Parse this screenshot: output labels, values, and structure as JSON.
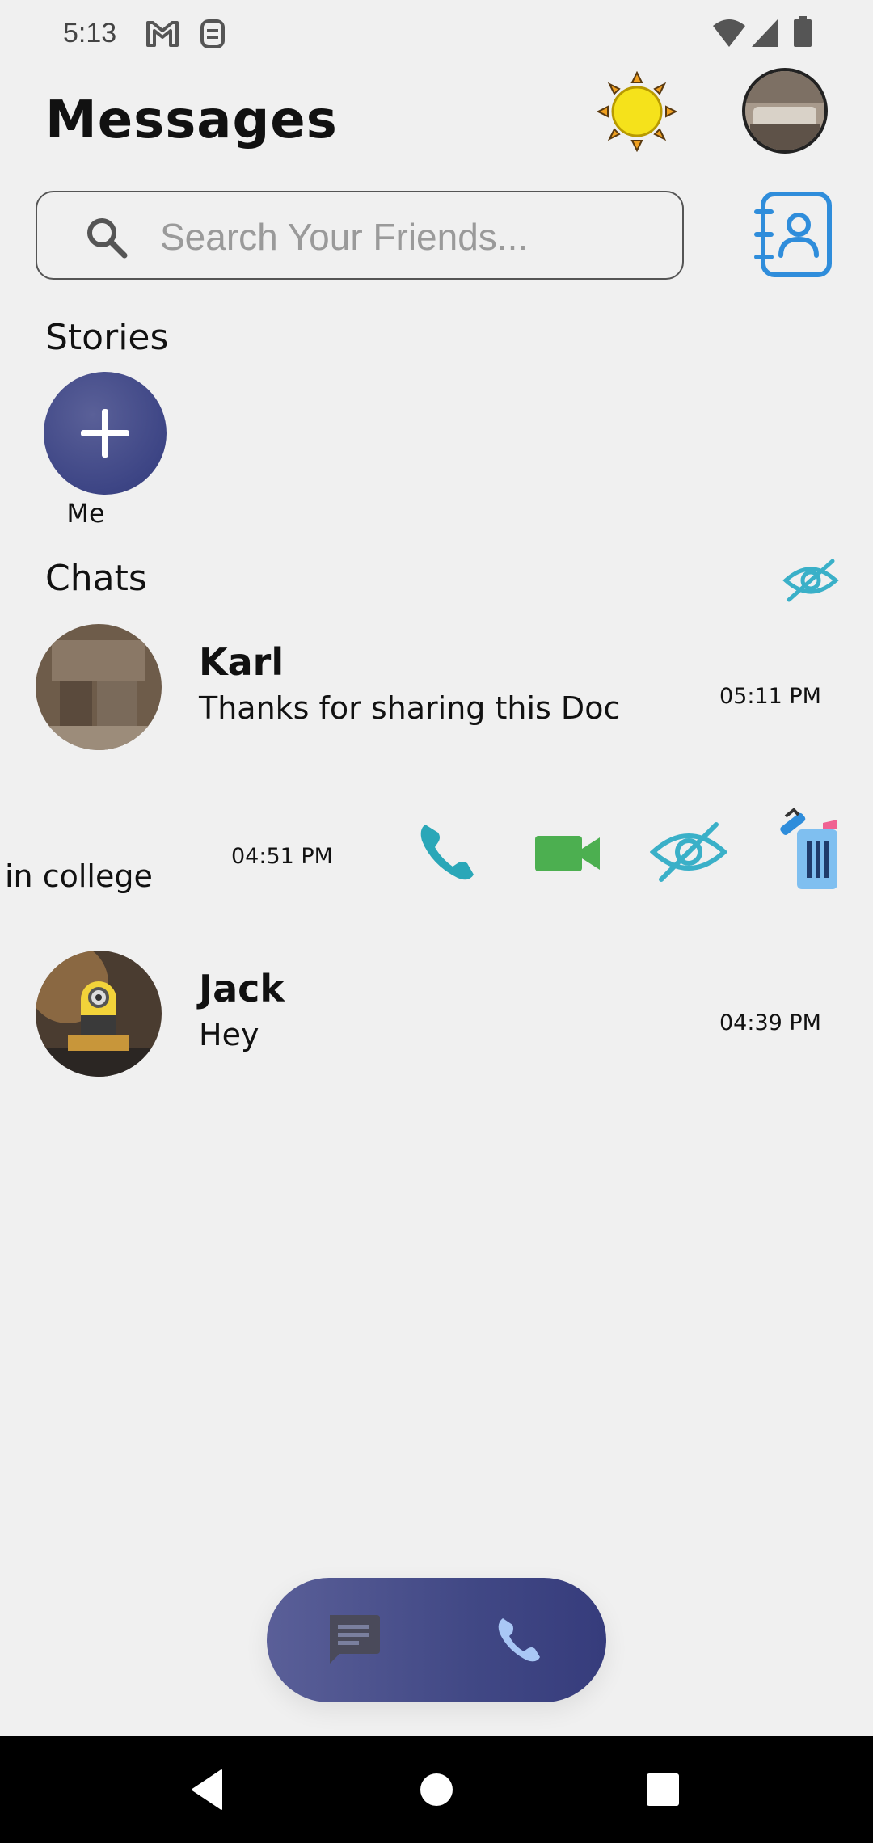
{
  "status_bar": {
    "time": "5:13",
    "icons": [
      "gmail-icon",
      "sync-icon",
      "wifi-icon",
      "signal-icon",
      "battery-icon"
    ]
  },
  "header": {
    "title": "Messages",
    "theme_toggle_icon": "sun-icon",
    "profile_avatar": "profile-photo"
  },
  "search": {
    "placeholder": "Search Your Friends...",
    "value": "",
    "contacts_icon": "contacts-book-icon"
  },
  "stories": {
    "title": "Stories",
    "items": [
      {
        "label": "Me",
        "icon": "plus-icon"
      }
    ]
  },
  "chats": {
    "title": "Chats",
    "hide_icon": "eye-off-icon",
    "items": [
      {
        "name": "Karl",
        "message": "Thanks for sharing this Doc",
        "time": "05:11 PM"
      },
      {
        "name": "",
        "message": "in college",
        "time": "04:51 PM",
        "swiped": true,
        "actions": [
          "phone-icon",
          "video-call-icon",
          "eye-off-icon",
          "trash-icon"
        ]
      },
      {
        "name": "Jack",
        "message": "Hey",
        "time": "04:39 PM"
      }
    ]
  },
  "bottom_tabs": [
    {
      "name": "chats-tab",
      "icon": "chat-icon"
    },
    {
      "name": "calls-tab",
      "icon": "phone-icon"
    }
  ],
  "colors": {
    "accent": "#3d4585",
    "call_teal": "#2aa7b8",
    "video_green": "#4caf50",
    "eye_teal": "#3ab0c8",
    "sun_yellow": "#f5e21b"
  }
}
